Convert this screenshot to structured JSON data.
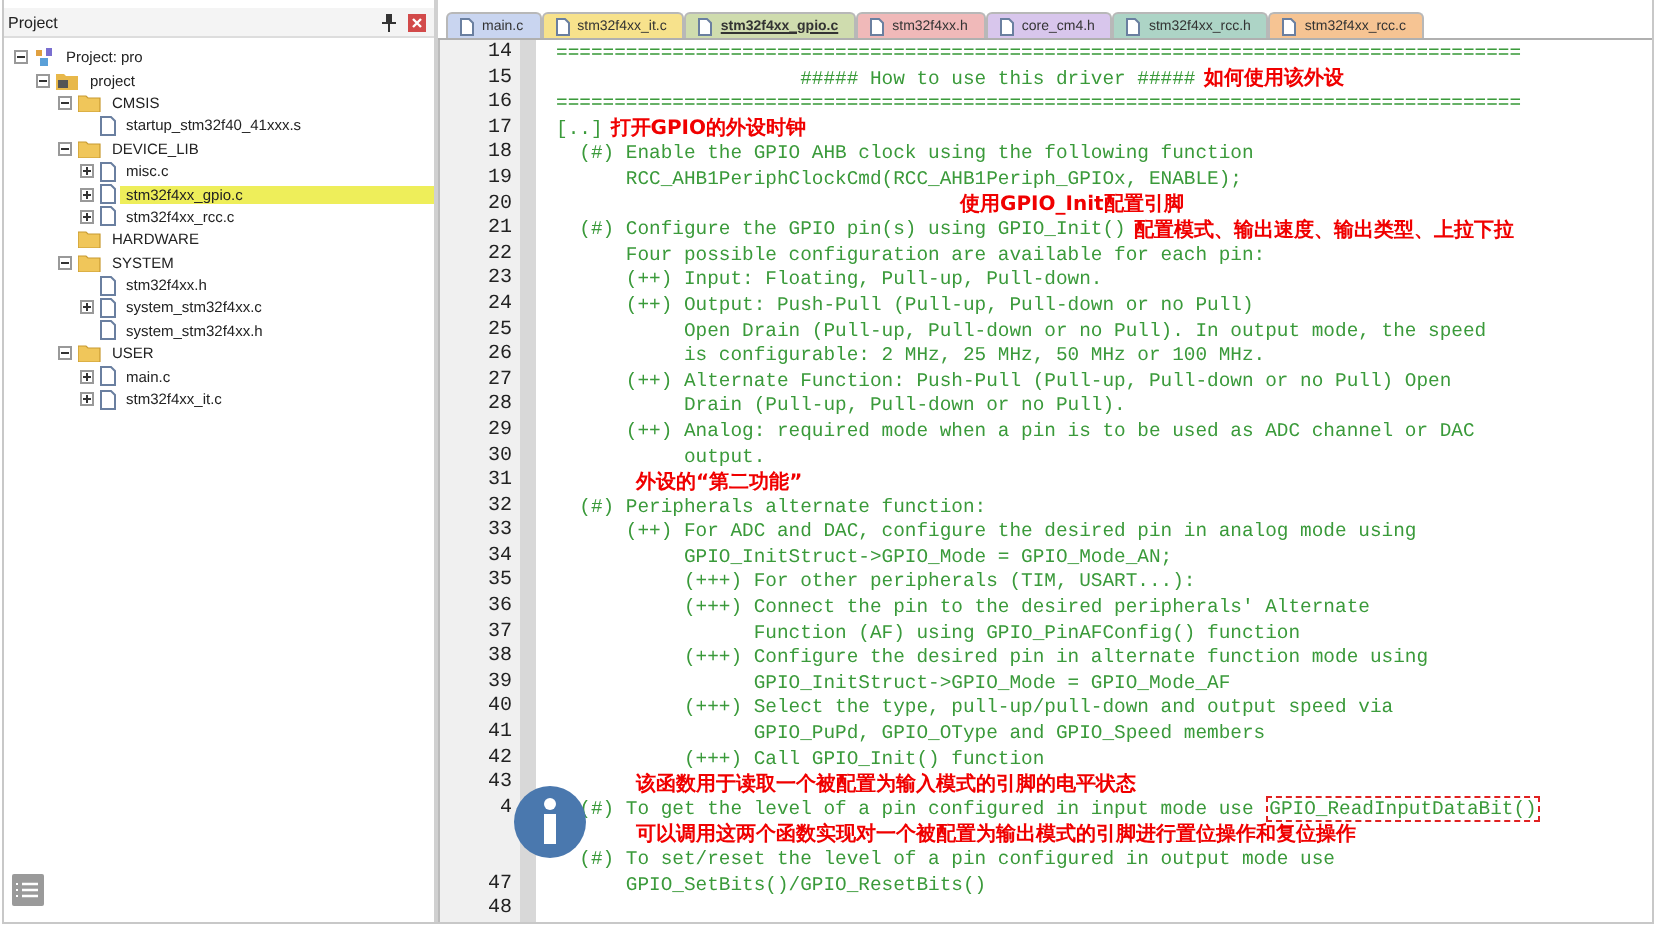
{
  "project_panel": {
    "title": "Project",
    "tree": [
      {
        "kind": "root",
        "label": "Project: pro",
        "expanded": true,
        "selected": false,
        "children": [
          {
            "kind": "target",
            "label": "project",
            "expanded": true,
            "selected": false,
            "children": [
              {
                "kind": "folder",
                "label": "CMSIS",
                "expanded": true,
                "selected": false,
                "children": [
                  {
                    "kind": "file",
                    "label": "startup_stm32f40_41xxx.s",
                    "selected": false
                  }
                ]
              },
              {
                "kind": "folder",
                "label": "DEVICE_LIB",
                "expanded": true,
                "selected": false,
                "children": [
                  {
                    "kind": "file",
                    "label": "misc.c",
                    "expanded": false,
                    "selected": false
                  },
                  {
                    "kind": "file",
                    "label": "stm32f4xx_gpio.c",
                    "expanded": false,
                    "selected": true
                  },
                  {
                    "kind": "file",
                    "label": "stm32f4xx_rcc.c",
                    "expanded": false,
                    "selected": false
                  }
                ]
              },
              {
                "kind": "folder",
                "label": "HARDWARE",
                "selected": false
              },
              {
                "kind": "folder",
                "label": "SYSTEM",
                "expanded": true,
                "selected": false,
                "children": [
                  {
                    "kind": "file",
                    "label": "stm32f4xx.h",
                    "selected": false
                  },
                  {
                    "kind": "file",
                    "label": "system_stm32f4xx.c",
                    "expanded": false,
                    "selected": false
                  },
                  {
                    "kind": "file",
                    "label": "system_stm32f4xx.h",
                    "selected": false
                  }
                ]
              },
              {
                "kind": "folder",
                "label": "USER",
                "expanded": true,
                "selected": false,
                "children": [
                  {
                    "kind": "file",
                    "label": "main.c",
                    "expanded": false,
                    "selected": false
                  },
                  {
                    "kind": "file",
                    "label": "stm32f4xx_it.c",
                    "expanded": false,
                    "selected": false
                  }
                ]
              }
            ]
          }
        ]
      }
    ]
  },
  "tabs": [
    {
      "label": "main.c",
      "color": "#c9d5f0",
      "selected": false
    },
    {
      "label": "stm32f4xx_it.c",
      "color": "#f7e28c",
      "selected": false
    },
    {
      "label": "stm32f4xx_gpio.c",
      "color": "#cfdcae",
      "selected": true
    },
    {
      "label": "stm32f4xx.h",
      "color": "#f0b9b9",
      "selected": false
    },
    {
      "label": "core_cm4.h",
      "color": "#d8c6ec",
      "selected": false
    },
    {
      "label": "stm32f4xx_rcc.h",
      "color": "#add4c6",
      "selected": false
    },
    {
      "label": "stm32f4xx_rcc.c",
      "color": "#f6c493",
      "selected": false
    }
  ],
  "editor": {
    "lines": [
      {
        "number": "14",
        "code": "==================================================================================="
      },
      {
        "number": "15",
        "code": "                     ##### How to use this driver #####",
        "note": "如何使用该外设"
      },
      {
        "number": "16",
        "code": "==================================================================================="
      },
      {
        "number": "17",
        "code": "[..]",
        "note": "打开GPIO的外设时钟"
      },
      {
        "number": "18",
        "code": "  (#) Enable the GPIO AHB clock using the following function"
      },
      {
        "number": "19",
        "code": "      RCC_AHB1PeriphClockCmd(RCC_AHB1Periph_GPIOx, ENABLE);"
      },
      {
        "number": "20",
        "kind": "centered_note",
        "note": "使用GPIO_Init配置引脚"
      },
      {
        "number": "21",
        "code": "  (#) Configure the GPIO pin(s) using GPIO_Init()",
        "note": "配置模式、输出速度、输出类型、上拉下拉"
      },
      {
        "number": "22",
        "code": "      Four possible configuration are available for each pin:"
      },
      {
        "number": "23",
        "code": "      (++) Input: Floating, Pull-up, Pull-down."
      },
      {
        "number": "24",
        "code": "      (++) Output: Push-Pull (Pull-up, Pull-down or no Pull)"
      },
      {
        "number": "25",
        "code": "           Open Drain (Pull-up, Pull-down or no Pull). In output mode, the speed"
      },
      {
        "number": "26",
        "code": "           is configurable: 2 MHz, 25 MHz, 50 MHz or 100 MHz."
      },
      {
        "number": "27",
        "code": "      (++) Alternate Function: Push-Pull (Pull-up, Pull-down or no Pull) Open"
      },
      {
        "number": "28",
        "code": "           Drain (Pull-up, Pull-down or no Pull)."
      },
      {
        "number": "29",
        "code": "      (++) Analog: required mode when a pin is to be used as ADC channel or DAC"
      },
      {
        "number": "30",
        "code": "           output."
      },
      {
        "number": "31",
        "kind": "indented_note",
        "note": "外设的“第二功能”"
      },
      {
        "number": "32",
        "code": "  (#) Peripherals alternate function:"
      },
      {
        "number": "33",
        "code": "      (++) For ADC and DAC, configure the desired pin in analog mode using"
      },
      {
        "number": "34",
        "code": "           GPIO_InitStruct->GPIO_Mode = GPIO_Mode_AN;"
      },
      {
        "number": "35",
        "code": "           (+++) For other peripherals (TIM, USART...):"
      },
      {
        "number": "36",
        "code": "           (+++) Connect the pin to the desired peripherals' Alternate"
      },
      {
        "number": "37",
        "code": "                 Function (AF) using GPIO_PinAFConfig() function"
      },
      {
        "number": "38",
        "code": "           (+++) Configure the desired pin in alternate function mode using"
      },
      {
        "number": "39",
        "code": "                 GPIO_InitStruct->GPIO_Mode = GPIO_Mode_AF"
      },
      {
        "number": "40",
        "code": "           (+++) Select the type, pull-up/pull-down and output speed via"
      },
      {
        "number": "41",
        "code": "                 GPIO_PuPd, GPIO_OType and GPIO_Speed members"
      },
      {
        "number": "42",
        "code": "           (+++) Call GPIO_Init() function"
      },
      {
        "number": "43",
        "kind": "indented_note",
        "note": "该函数用于读取一个被配置为输入模式的引脚的电平状态"
      },
      {
        "number": "4",
        "code": "  (#) To get the level of a pin configured in input mode use ",
        "highlight": "GPIO_ReadInputDataBit()"
      },
      {
        "kind": "indented_note",
        "note": "可以调用这两个函数实现对一个被配置为输出模式的引脚进行置位操作和复位操作"
      },
      {
        "code": "  (#) To set/reset the level of a pin configured in output mode use"
      },
      {
        "number": "47",
        "code": "      GPIO_SetBits()/GPIO_ResetBits()"
      },
      {
        "number": "48"
      }
    ]
  }
}
